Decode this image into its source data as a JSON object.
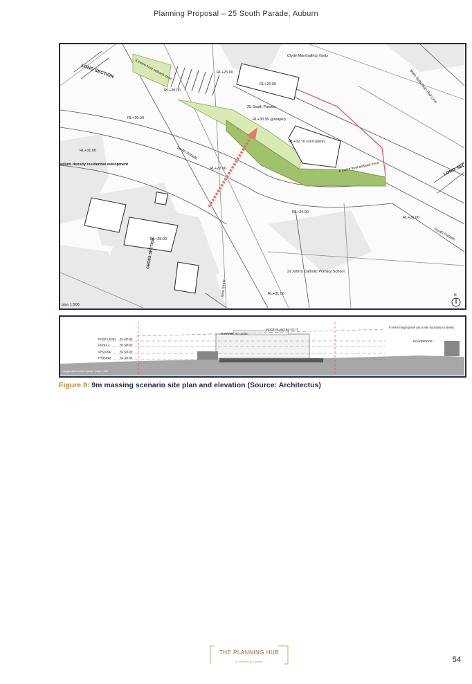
{
  "header": {
    "title": "Planning Proposal – 25 South Parade, Auburn"
  },
  "plan": {
    "labels": {
      "long_section_left": "LONG SECTION",
      "long_section_right": "LONG SECTION",
      "setback_top": "6 metre front setback zone",
      "setback_bottom": "6 metre front setback zone",
      "rl_25_top": "RL+25.00",
      "rl_26_top": "RL+26.00",
      "rl_20_a": "RL+20.00",
      "rl_20_b": "RL+20.00",
      "clyde": "Clyde Marshalling Yards",
      "south_parade_25": "25 South Parade",
      "rl_parapet": "RL+30.95 (parapet)",
      "main_line": "Main Suburban Rail Line",
      "rl_31_left": "RL+31.00",
      "med_density": "edium density residential evelopment",
      "south_parade_road": "South Parade",
      "rl_roof_plant": "RL+32.70 (roof plant)",
      "rl_22": "RL+22.00",
      "rl_24": "RL+24.00",
      "rl_26_right": "RL+26.00",
      "south_parade_right": "South Parade",
      "rl_25_mid": "RL+25.00",
      "cross_section": "CROSS SECTION",
      "st_johns": "St John's Catholic Primary School",
      "alice_street": "Alice Street",
      "rl_31_bottom": "RL+31.00",
      "scale": "plan 1:500",
      "north": "N"
    }
  },
  "elevation": {
    "labels": {
      "roof_level": "ROOF LEVEL",
      "roof_level_rl": "RL+30.95",
      "level_1": "LEVEL 1",
      "level_1_rl": "RL+28.50",
      "ground": "GROUND",
      "ground_rl": "RL+25.00",
      "parking": "PARKING",
      "parking_rl": "RL+22.00",
      "parapet": "PARAPET RL+30.95",
      "roof_plant": "ROOF PLANT RL+32.70",
      "height_plane": "9 metre height plane (as at site boundary to street)",
      "roadbridge": "ROADBRIDGE",
      "section_note": "Longitudinal section (west - east) 1:500"
    }
  },
  "caption": {
    "label": "Figure 9:",
    "text": " 9m massing scenario site plan and elevation (Source: Architectus)"
  },
  "footer": {
    "logo_text": "THE PLANNING HUB",
    "logo_tagline": "by Abraham & Graziano",
    "page_number": "54"
  },
  "colors": {
    "frame": "#1f2a4a",
    "caption_label": "#b8862e",
    "setback_light": "#d9e9b4",
    "setback_dark": "#9fc26a",
    "boundary": "#e05a4e"
  }
}
